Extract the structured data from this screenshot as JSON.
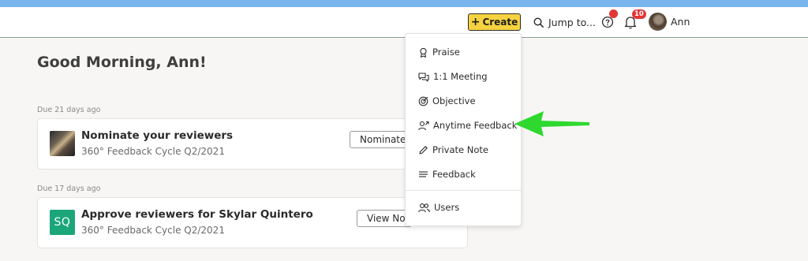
{
  "header": {
    "create_label": "Create",
    "jump_label": "Jump to...",
    "notification_count": "10",
    "user_name": "Ann"
  },
  "greeting": "Good Morning, Ann!",
  "tasks": [
    {
      "due": "Due 21 days ago",
      "title": "Nominate your reviewers",
      "subtitle": "360° Feedback Cycle Q2/2021",
      "action_label": "Nominate"
    },
    {
      "due": "Due 17 days ago",
      "title": "Approve reviewers for Skylar Quintero",
      "subtitle": "360° Feedback Cycle Q2/2021",
      "initials": "SQ",
      "action_label": "View Nominations"
    }
  ],
  "create_menu": {
    "items": [
      {
        "label": "Praise",
        "icon": "award-icon"
      },
      {
        "label": "1:1 Meeting",
        "icon": "chat-bubbles-icon"
      },
      {
        "label": "Objective",
        "icon": "target-icon"
      },
      {
        "label": "Anytime Feedback",
        "icon": "person-arrow-icon"
      },
      {
        "label": "Private Note",
        "icon": "pencil-icon"
      },
      {
        "label": "Feedback",
        "icon": "lines-icon"
      },
      {
        "label": "Users",
        "icon": "users-icon"
      }
    ]
  },
  "colors": {
    "top_strip": "#79b5ea",
    "create_button": "#f6d23f",
    "badge": "#e33636",
    "avatar_sq": "#1ba67a",
    "arrow": "#2fd82f"
  }
}
